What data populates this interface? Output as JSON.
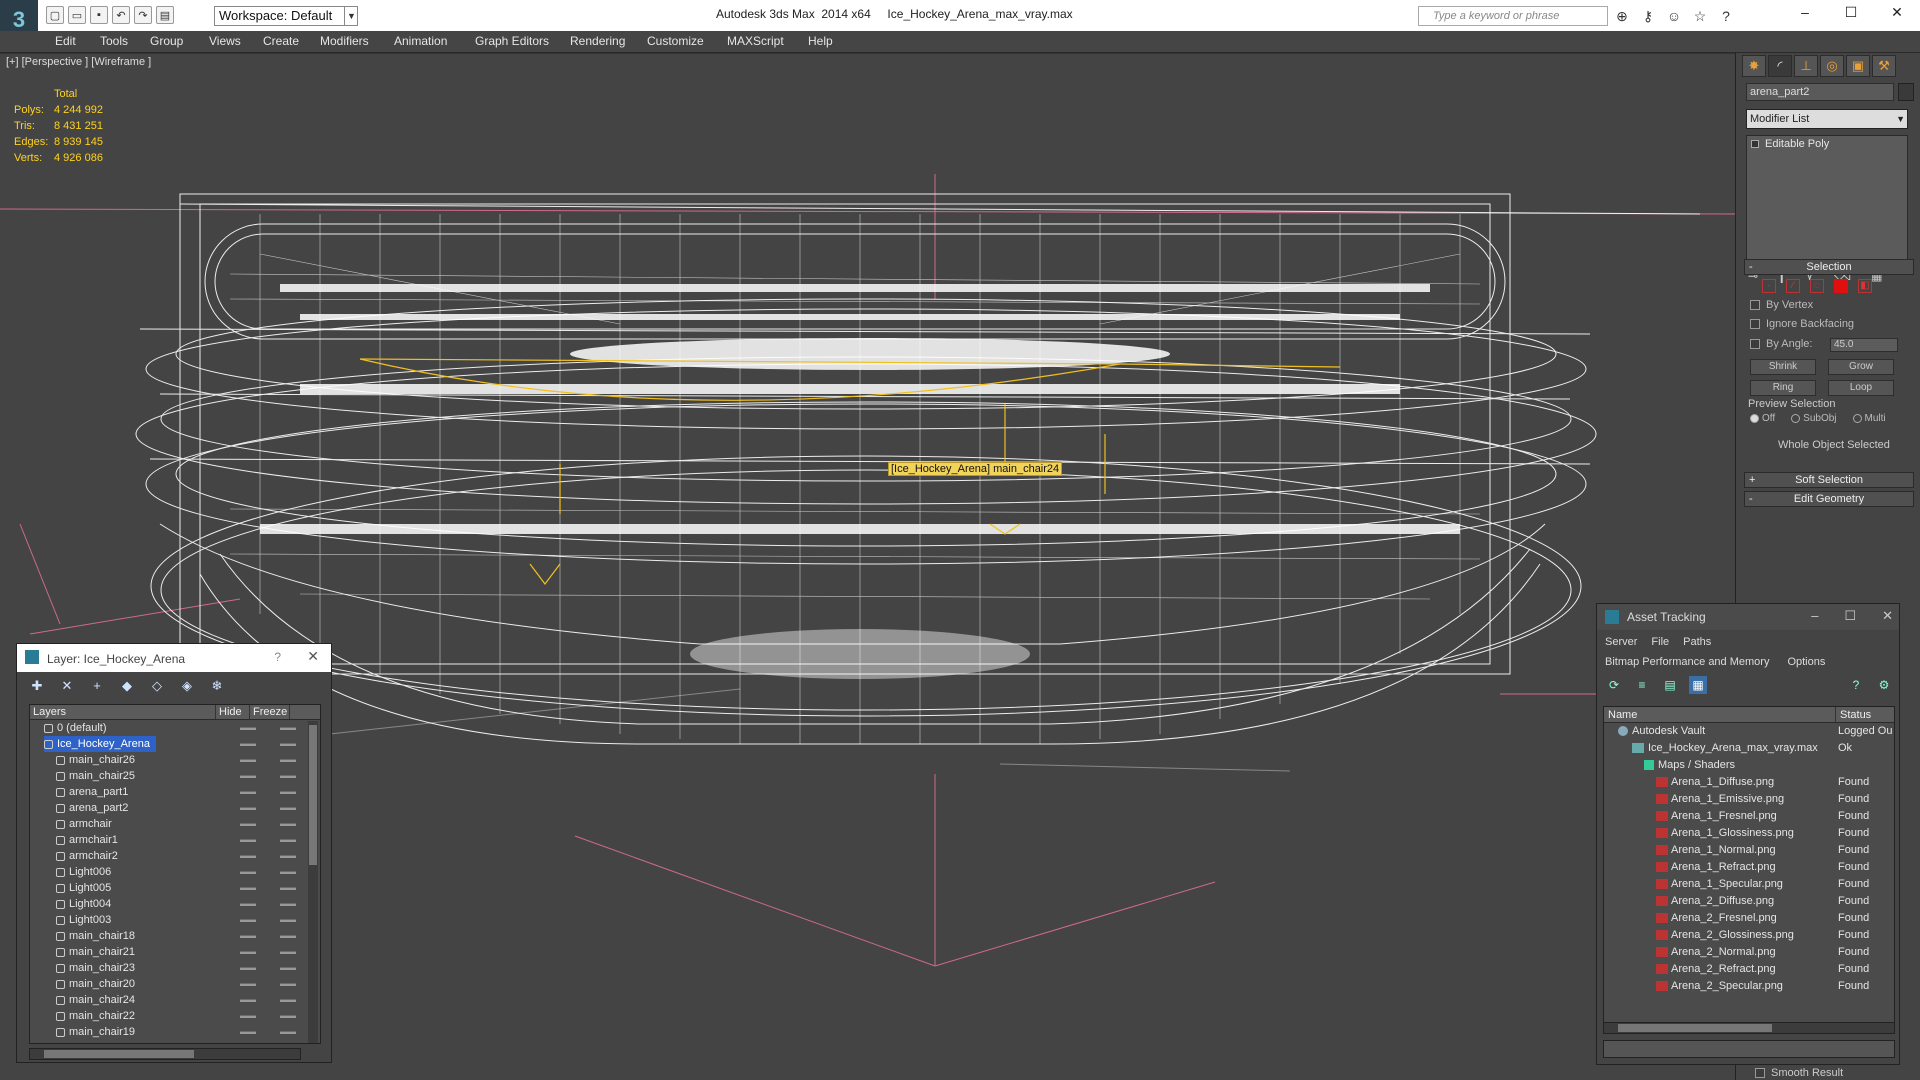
{
  "titlebar": {
    "app_logo": "3",
    "workspace": "Workspace: Default",
    "window_title": "Autodesk 3ds Max  2014 x64     Ice_Hockey_Arena_max_vray.max",
    "search_placeholder": "Type a keyword or phrase",
    "qa_icons": [
      "new-file-icon",
      "open-folder-icon",
      "save-icon",
      "undo-icon",
      "redo-icon",
      "hold-icon"
    ],
    "help_icons": [
      "binoculars-icon",
      "key-icon",
      "person-icon",
      "star-icon",
      "help-icon"
    ],
    "window_controls": [
      "–",
      "☐",
      "✕"
    ]
  },
  "menu": [
    "Edit",
    "Tools",
    "Group",
    "Views",
    "Create",
    "Modifiers",
    "Animation",
    "Graph Editors",
    "Rendering",
    "Customize",
    "MAXScript",
    "Help"
  ],
  "viewport": {
    "label": "[+] [Perspective ] [Wireframe ]",
    "stats": {
      "header": "Total",
      "polys_label": "Polys:",
      "polys": "4 244 992",
      "tris_label": "Tris:",
      "tris": "8 431 251",
      "edges_label": "Edges:",
      "edges": "8 939 145",
      "verts_label": "Verts:",
      "verts": "4 926 086"
    },
    "tooltip": "[Ice_Hockey_Arena] main_chair24",
    "colors": {
      "wire": "#ffffff",
      "selected": "#f0c020",
      "axis": "#d06a8a",
      "stats": "#ffd21e"
    }
  },
  "command_panel": {
    "tabs": [
      "create-icon",
      "modify-icon",
      "hierarchy-icon",
      "motion-icon",
      "display-icon",
      "utilities-icon"
    ],
    "object_name": "arena_part2",
    "modifier_list": "Modifier List",
    "stack_entry": "Editable Poly",
    "selection_title": "Selection",
    "by_vertex": "By Vertex",
    "ignore_backfacing": "Ignore Backfacing",
    "by_angle": "By Angle:",
    "angle_value": "45.0",
    "shrink": "Shrink",
    "grow": "Grow",
    "ring": "Ring",
    "loop": "Loop",
    "preview_selection": "Preview Selection",
    "preview_off": "Off",
    "preview_subobj": "SubObj",
    "preview_multi": "Multi",
    "whole_object": "Whole Object Selected",
    "soft_selection": "Soft Selection",
    "edit_geometry": "Edit Geometry",
    "smooth_result": "Smooth Result"
  },
  "layer_dialog": {
    "title": "Layer: Ice_Hockey_Arena",
    "help": "?",
    "close": "✕",
    "col_layers": "Layers",
    "col_hide": "Hide",
    "col_freeze": "Freeze",
    "rows": [
      {
        "name": "0 (default)",
        "indent": 1
      },
      {
        "name": "Ice_Hockey_Arena",
        "indent": 1,
        "selected": true
      },
      {
        "name": "main_chair26",
        "indent": 2
      },
      {
        "name": "main_chair25",
        "indent": 2
      },
      {
        "name": "arena_part1",
        "indent": 2
      },
      {
        "name": "arena_part2",
        "indent": 2
      },
      {
        "name": "armchair",
        "indent": 2
      },
      {
        "name": "armchair1",
        "indent": 2
      },
      {
        "name": "armchair2",
        "indent": 2
      },
      {
        "name": "Light006",
        "indent": 2
      },
      {
        "name": "Light005",
        "indent": 2
      },
      {
        "name": "Light004",
        "indent": 2
      },
      {
        "name": "Light003",
        "indent": 2
      },
      {
        "name": "main_chair18",
        "indent": 2
      },
      {
        "name": "main_chair21",
        "indent": 2
      },
      {
        "name": "main_chair23",
        "indent": 2
      },
      {
        "name": "main_chair20",
        "indent": 2
      },
      {
        "name": "main_chair24",
        "indent": 2
      },
      {
        "name": "main_chair22",
        "indent": 2
      },
      {
        "name": "main_chair19",
        "indent": 2
      }
    ]
  },
  "asset_dialog": {
    "title": "Asset Tracking",
    "menu1": [
      "Server",
      "File",
      "Paths"
    ],
    "menu2": [
      "Bitmap Performance and Memory",
      "Options"
    ],
    "col_name": "Name",
    "col_status": "Status",
    "rows": [
      {
        "name": "Autodesk Vault",
        "status": "Logged Ou",
        "kind": "vault",
        "indent": 1
      },
      {
        "name": "Ice_Hockey_Arena_max_vray.max",
        "status": "Ok",
        "kind": "max",
        "indent": 2
      },
      {
        "name": "Maps / Shaders",
        "status": "",
        "kind": "folder",
        "indent": 3
      },
      {
        "name": "Arena_1_Diffuse.png",
        "status": "Found",
        "kind": "png",
        "indent": 4
      },
      {
        "name": "Arena_1_Emissive.png",
        "status": "Found",
        "kind": "png",
        "indent": 4
      },
      {
        "name": "Arena_1_Fresnel.png",
        "status": "Found",
        "kind": "png",
        "indent": 4
      },
      {
        "name": "Arena_1_Glossiness.png",
        "status": "Found",
        "kind": "png",
        "indent": 4
      },
      {
        "name": "Arena_1_Normal.png",
        "status": "Found",
        "kind": "png",
        "indent": 4
      },
      {
        "name": "Arena_1_Refract.png",
        "status": "Found",
        "kind": "png",
        "indent": 4
      },
      {
        "name": "Arena_1_Specular.png",
        "status": "Found",
        "kind": "png",
        "indent": 4
      },
      {
        "name": "Arena_2_Diffuse.png",
        "status": "Found",
        "kind": "png",
        "indent": 4
      },
      {
        "name": "Arena_2_Fresnel.png",
        "status": "Found",
        "kind": "png",
        "indent": 4
      },
      {
        "name": "Arena_2_Glossiness.png",
        "status": "Found",
        "kind": "png",
        "indent": 4
      },
      {
        "name": "Arena_2_Normal.png",
        "status": "Found",
        "kind": "png",
        "indent": 4
      },
      {
        "name": "Arena_2_Refract.png",
        "status": "Found",
        "kind": "png",
        "indent": 4
      },
      {
        "name": "Arena_2_Specular.png",
        "status": "Found",
        "kind": "png",
        "indent": 4
      }
    ]
  }
}
